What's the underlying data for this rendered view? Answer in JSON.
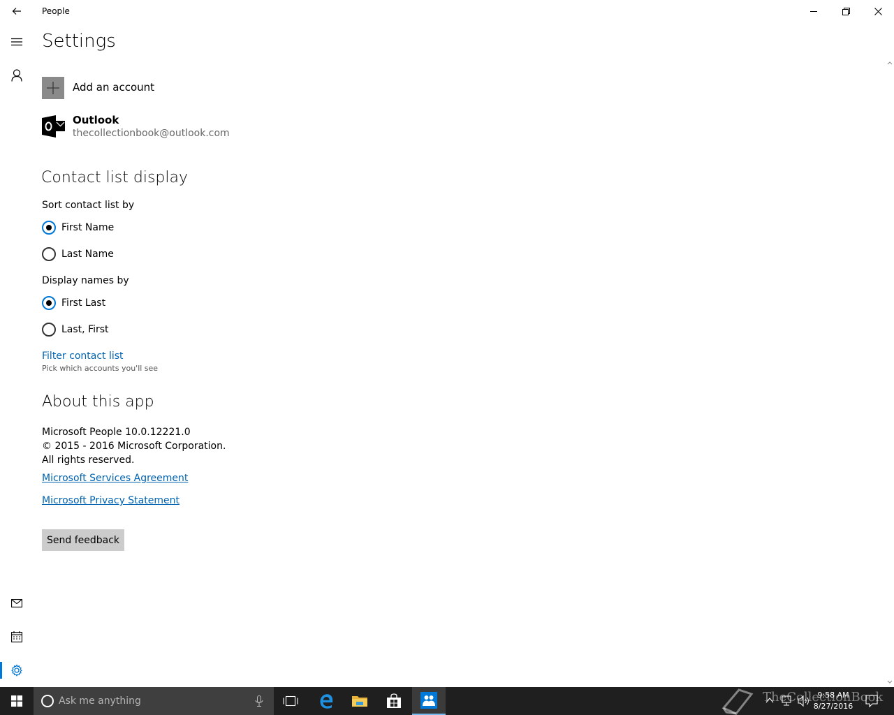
{
  "window": {
    "app_title": "People"
  },
  "page": {
    "title": "Settings"
  },
  "accounts": {
    "add_label": "Add an account",
    "items": [
      {
        "name": "Outlook",
        "email": "thecollectionbook@outlook.com",
        "icon": "outlook-icon"
      }
    ]
  },
  "contact_display": {
    "heading": "Contact list display",
    "sort_label": "Sort contact list by",
    "sort_options": [
      {
        "label": "First Name",
        "selected": true
      },
      {
        "label": "Last Name",
        "selected": false
      }
    ],
    "display_label": "Display names by",
    "display_options": [
      {
        "label": "First Last",
        "selected": true
      },
      {
        "label": "Last, First",
        "selected": false
      }
    ],
    "filter_link": "Filter contact list",
    "filter_hint": "Pick which accounts you'll see"
  },
  "about": {
    "heading": "About this app",
    "version": "Microsoft People 10.0.12221.0",
    "copyright": "© 2015 - 2016 Microsoft Corporation.",
    "rights": "All rights reserved.",
    "services_link": "Microsoft Services Agreement",
    "privacy_link": "Microsoft Privacy Statement",
    "feedback_button": "Send feedback"
  },
  "taskbar": {
    "search_placeholder": "Ask me anything",
    "clock_time": "9:58 AM",
    "clock_date": "8/27/2016",
    "watermark": "TheCollectionBook"
  },
  "colors": {
    "accent": "#0078d7",
    "link": "#0063b1",
    "taskbar": "#1f1f1f"
  }
}
